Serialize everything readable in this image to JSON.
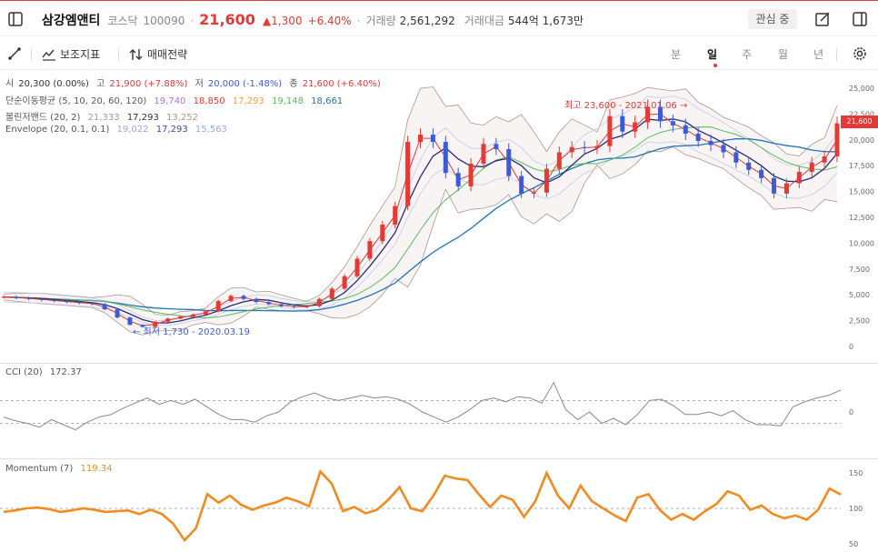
{
  "header": {
    "stock_name": "삼강엠앤티",
    "market": "코스닥",
    "code": "100090",
    "dot": "·",
    "price": "21,600",
    "change": "▲1,300",
    "change_pct": "+6.40%",
    "volume_label": "거래량",
    "volume": "2,561,292",
    "value_label": "거래대금",
    "value": "544억 1,673만",
    "watch_label": "관심 중"
  },
  "toolbar": {
    "sub_indicator_label": "보조지표",
    "strategy_label": "매매전략",
    "periods": [
      "분",
      "일",
      "주",
      "월",
      "년"
    ],
    "active_period": "일"
  },
  "legend": {
    "ohlc": {
      "open_label": "시",
      "open": "20,300 (0.00%)",
      "high_label": "고",
      "high": "21,900 (+7.88%)",
      "low_label": "저",
      "low": "20,000 (-1.48%)",
      "close_label": "종",
      "close": "21,600 (+6.40%)"
    },
    "sma": {
      "label": "단순이동평균 (5, 10, 20, 60, 120)",
      "values": [
        "19,740",
        "18,850",
        "17,293",
        "19,148",
        "18,661"
      ],
      "colors": [
        "#a678d6",
        "#e53935",
        "#f2a12e",
        "#5cb85c",
        "#1e73be"
      ]
    },
    "bollinger": {
      "label": "볼린저밴드 (20, 2)",
      "values": [
        "21,333",
        "17,293",
        "13,252"
      ],
      "colors": [
        "#b0968a",
        "#333333",
        "#b0968a"
      ]
    },
    "envelope": {
      "label": "Envelope (20, 0.1, 0.1)",
      "values": [
        "19,022",
        "17,293",
        "15,563"
      ],
      "colors": [
        "#9aa6e6",
        "#3b4ba8",
        "#9aa6e6"
      ]
    }
  },
  "annotations": {
    "high": "최고 23,600 - 2021.01.06 →",
    "low": "← 최저 1,730 - 2020.03.19"
  },
  "price_tag": "21,600",
  "cci": {
    "label": "CCI (20)",
    "value": "172.37",
    "axis": [
      "0"
    ]
  },
  "momentum": {
    "label": "Momentum (7)",
    "value": "119.34",
    "axis": [
      "150",
      "100",
      "50"
    ]
  },
  "colors": {
    "up": "#e53935",
    "down": "#3b5bdb",
    "momentum": "#f28a1e",
    "cci": "#888888"
  },
  "chart_data": [
    {
      "type": "line",
      "title": "",
      "y_axis_ticks": [
        0,
        2500,
        5000,
        7500,
        10000,
        12500,
        15000,
        17500,
        20000,
        22500,
        25000
      ],
      "ylim": [
        0,
        25000
      ],
      "series": [
        {
          "name": "종가",
          "values": [
            4800,
            4700,
            4600,
            4500,
            4400,
            4300,
            4200,
            4100,
            3600,
            2800,
            2100,
            1900,
            2400,
            2700,
            2900,
            3100,
            3400,
            4400,
            4900,
            4600,
            4300,
            4100,
            3900,
            3800,
            3900,
            4600,
            5600,
            6800,
            8500,
            10200,
            11800,
            13600,
            19800,
            20500,
            19800,
            16800,
            15500,
            17700,
            19600,
            19100,
            16500,
            14800,
            14900,
            17200,
            18800,
            19300,
            19200,
            19400,
            22300,
            20800,
            21700,
            23200,
            21800,
            21400,
            20600,
            19900,
            19500,
            18800,
            17800,
            17100,
            16300,
            14800,
            15800,
            16900,
            17800,
            18400,
            21600
          ]
        }
      ]
    },
    {
      "type": "line",
      "title": "",
      "y_axis_ticks": [
        0
      ],
      "series": [
        {
          "name": "CCI (20)",
          "values": [
            -40,
            -70,
            -90,
            -120,
            -60,
            -100,
            -140,
            -80,
            -40,
            -20,
            30,
            70,
            110,
            60,
            90,
            60,
            100,
            40,
            -20,
            -60,
            -60,
            -80,
            -30,
            0,
            80,
            120,
            150,
            110,
            90,
            110,
            130,
            110,
            120,
            100,
            60,
            0,
            -40,
            -80,
            -40,
            20,
            90,
            110,
            80,
            120,
            110,
            70,
            230,
            20,
            -60,
            0,
            -90,
            -50,
            -100,
            -20,
            90,
            100,
            50,
            -20,
            -20,
            0,
            -30,
            10,
            -60,
            -100,
            -100,
            -110,
            40,
            80,
            110,
            130,
            172.37
          ]
        }
      ]
    },
    {
      "type": "line",
      "title": "",
      "y_axis_ticks": [
        50,
        100,
        150
      ],
      "series": [
        {
          "name": "Momentum (7)",
          "values": [
            95,
            97,
            100,
            101,
            99,
            95,
            97,
            100,
            98,
            95,
            96,
            97,
            92,
            98,
            92,
            78,
            55,
            72,
            120,
            108,
            118,
            105,
            98,
            104,
            108,
            115,
            110,
            103,
            152,
            135,
            96,
            102,
            93,
            98,
            112,
            130,
            100,
            96,
            118,
            146,
            142,
            140,
            120,
            102,
            118,
            112,
            88,
            110,
            150,
            118,
            100,
            132,
            110,
            100,
            90,
            82,
            115,
            120,
            98,
            84,
            92,
            84,
            96,
            106,
            124,
            118,
            98,
            104,
            92,
            86,
            90,
            84,
            98,
            128,
            119.34
          ]
        }
      ]
    }
  ]
}
